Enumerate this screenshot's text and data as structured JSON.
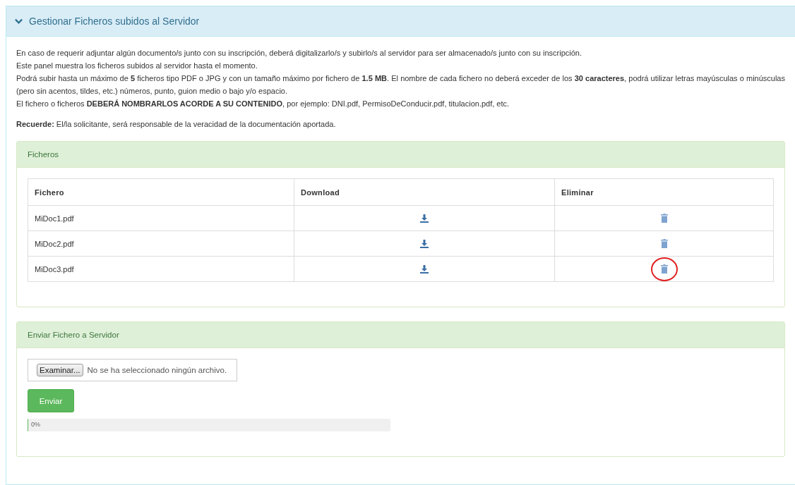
{
  "panel": {
    "title": "Gestionar Ficheros subidos al Servidor",
    "expanded": true
  },
  "paragraphs": [
    "En caso de requerir adjuntar algún documento/s junto con su inscripción, deberá digitalizarlo/s y subirlo/s al servidor para ser almacenado/s junto con su inscripción.",
    "Este panel muestra los ficheros subidos al servidor hasta el momento.",
    "Podrá subir hasta un máximo de **5** ficheros tipo PDF o JPG y con un tamaño máximo por fichero de **1.5 MB**. El nombre de cada fichero no deberá exceder de los **30 caracteres**, podrá utilizar letras mayúsculas o minúsculas (pero sin acentos, tildes, etc.) números, punto, guion medio o bajo y/o espacio.",
    "El fichero o ficheros **DEBERÁ NOMBRARLOS ACORDE A SU CONTENIDO**, por ejemplo: DNI.pdf, PermisoDeConducir.pdf, titulacion.pdf, etc."
  ],
  "reminder": "**Recuerde:** El/la solicitante, será responsable de la veracidad de la documentación aportada.",
  "files_panel": {
    "title": "Ficheros",
    "columns": [
      "Fichero",
      "Download",
      "Eliminar"
    ],
    "rows": [
      {
        "name": "MiDoc1.pdf",
        "highlighted": false
      },
      {
        "name": "MiDoc2.pdf",
        "highlighted": false
      },
      {
        "name": "MiDoc3.pdf",
        "highlighted": true
      }
    ]
  },
  "upload_panel": {
    "title": "Enviar Fichero a Servidor",
    "browse_button": "Examinar...",
    "file_status": "No se ha seleccionado ningún archivo.",
    "send_button": "Enviar",
    "progress": {
      "level": 0,
      "reading": "0%"
    }
  }
}
